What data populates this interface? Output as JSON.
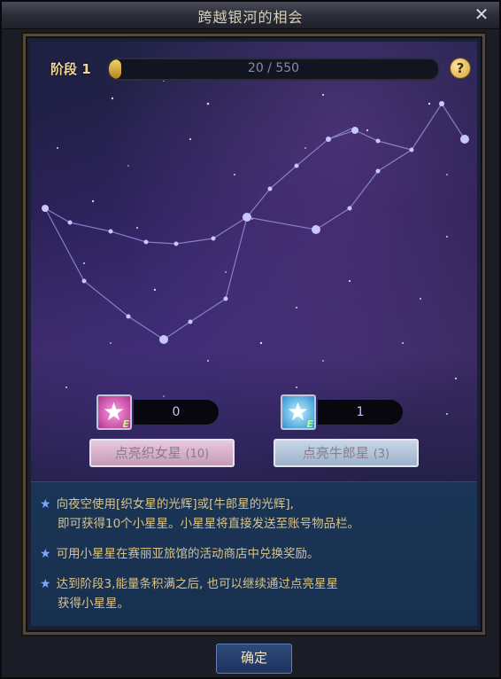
{
  "window": {
    "title": "跨越银河的相会",
    "close_glyph": "✕"
  },
  "stage": {
    "label": "阶段 1",
    "progress_text": "20 / 550",
    "progress_fraction": 0.0364
  },
  "help_glyph": "?",
  "items": [
    {
      "count": "0",
      "button_label": "点亮织女星",
      "button_count": "(10)",
      "e_label": "E"
    },
    {
      "count": "1",
      "button_label": "点亮牛郎星",
      "button_count": "(3)",
      "e_label": "E"
    }
  ],
  "info": {
    "line1a": "向夜空使用[织女星的光辉]或[牛郎星的光辉],",
    "line1b": "即可获得10个小星星。小星星将直接发送至账号物品栏。",
    "line2": "可用小星星在赛丽亚旅馆的活动商店中兑换奖励。",
    "line3a": "达到阶段3,能量条积满之后, 也可以继续通过点亮星星",
    "line3b": "获得小星星。",
    "bullet_glyph": "★"
  },
  "confirm_label": "确定",
  "colors": {
    "accent": "#f0d79a",
    "sky_top": "#1d2143",
    "info_bg": "#1b3557"
  }
}
